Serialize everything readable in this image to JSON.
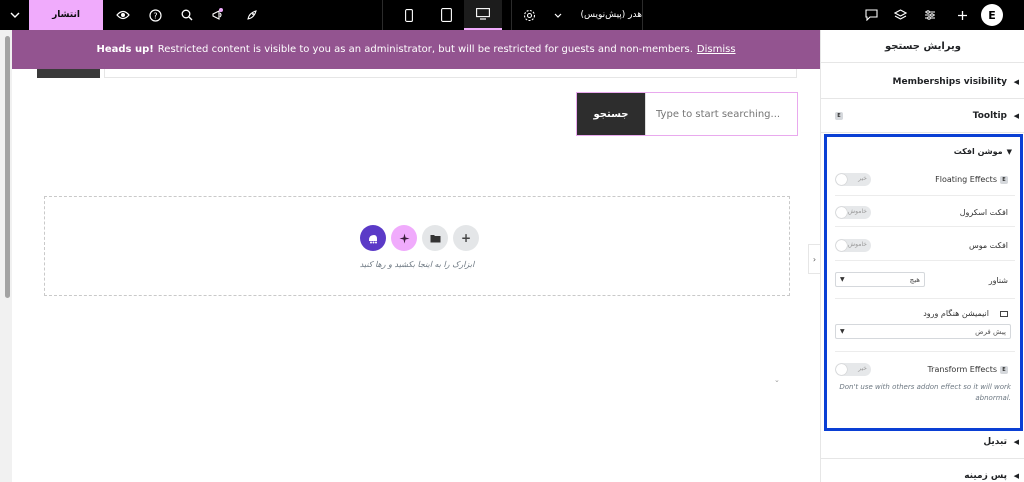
{
  "topbar": {
    "publish_label": "انتشار",
    "document_title": "هدر (پیش‌نویس)"
  },
  "banner": {
    "bold": "Heads up!",
    "message": "Restricted content is visible to you as an administrator, but will be restricted for guests and non-members.",
    "dismiss": "Dismiss"
  },
  "search": {
    "button_label": "جستجو",
    "placeholder": "Type to start searching..."
  },
  "dropzone": {
    "hint": "ابزارک را به اینجا بکشید و رها کنید"
  },
  "panel": {
    "title": "ویرایش جستجو",
    "sections": {
      "memberships": "Memberships visibility",
      "tooltip": "Tooltip",
      "motion": "موشن افکت",
      "transform": "تبدیل",
      "background": "پس زمینه"
    },
    "motion": {
      "floating_effects": "Floating Effects",
      "floating_value": "خیر",
      "scroll_effect": "افکت اسکرول",
      "scroll_value": "خاموش",
      "mouse_effect": "افکت موس",
      "mouse_value": "خاموش",
      "sticky": "شناور",
      "sticky_value": "هیچ",
      "entrance_animation": "انیمیشن هنگام ورود",
      "entrance_value": "پیش فرض",
      "transform_effects": "Transform Effects",
      "transform_value": "خیر",
      "note": "Don't use with others addon effect so it will work abnormal."
    }
  },
  "colors": {
    "accent": "#f0abfc",
    "banner": "#935490",
    "highlight": "#0a3fd4",
    "ai_button": "#5b3ac7"
  }
}
